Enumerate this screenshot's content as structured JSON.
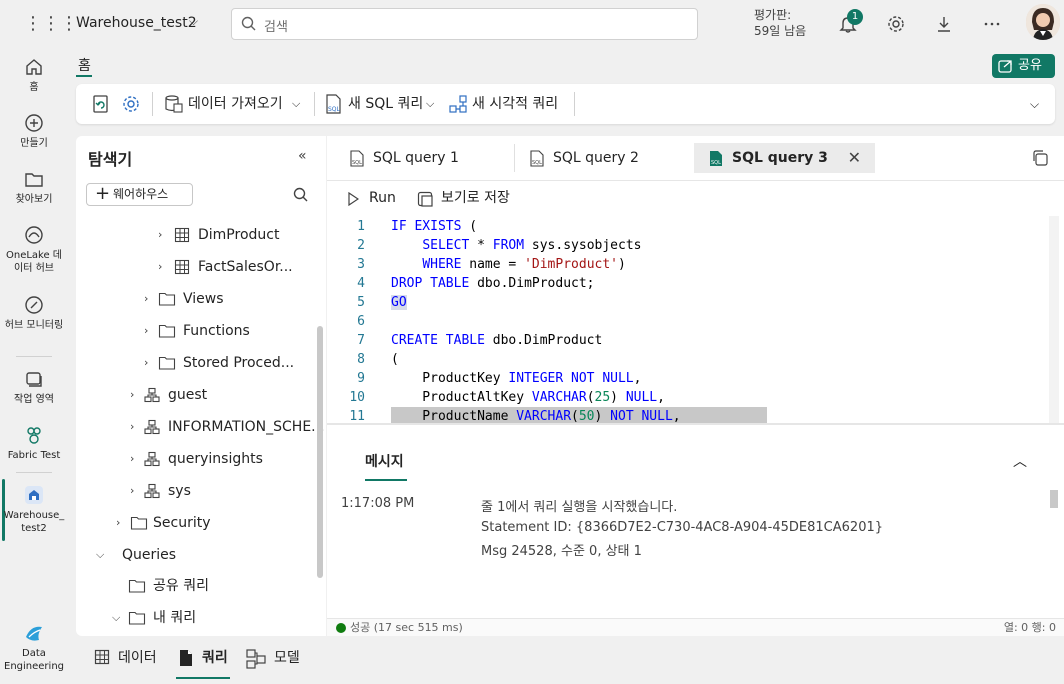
{
  "rail": {
    "home": "홈",
    "create": "만들기",
    "browse": "찾아보기",
    "onelake": "OneLake 데이터 허브",
    "monitor": "허브 모니터링",
    "workspace": "작업 영역",
    "fabric_test": "Fabric Test",
    "warehouse": "Warehouse_ test2",
    "data_engineering": "Data Engineering"
  },
  "topbar": {
    "workspace_name": "Warehouse_test2",
    "search_placeholder": "검색",
    "trial_line1": "평가판:",
    "trial_line2": "59일 남음",
    "notification_count": "1"
  },
  "ribbon": {
    "tab_home": "홈",
    "share": "공유",
    "get_data": "데이터 가져오기",
    "new_sql_query": "새 SQL 쿼리",
    "new_visual_query": "새 시각적 쿼리"
  },
  "explorer": {
    "title": "탐색기",
    "warehouse_button": "웨어하우스",
    "items": [
      "DimProduct",
      "FactSalesOr...",
      "Views",
      "Functions",
      "Stored Proced...",
      "guest",
      "INFORMATION_SCHE...",
      "queryinsights",
      "sys",
      "Security",
      "Queries",
      "공유 쿼리",
      "내 쿼리"
    ]
  },
  "editor": {
    "tabs": [
      "SQL query 1",
      "SQL query 2",
      "SQL query 3"
    ],
    "run": "Run",
    "save_as_view": "보기로 저장",
    "line_numbers": [
      "1",
      "2",
      "3",
      "4",
      "5",
      "6",
      "7",
      "8",
      "9",
      "10",
      "11"
    ]
  },
  "messages": {
    "tab": "메시지",
    "time": "1:17:08 PM",
    "line1": "줄 1에서 쿼리 실행을 시작했습니다.",
    "line2": "Statement ID: {8366D7E2-C730-4AC8-A904-45DE81CA6201}",
    "line3": "Msg 24528, 수준 0, 상태 1"
  },
  "status": {
    "left": "성공 (17 sec 515 ms)",
    "right": "열: 0  행: 0"
  },
  "view_tabs": {
    "data": "데이터",
    "query": "쿼리",
    "model": "모델"
  },
  "colors": {
    "accent": "#117865",
    "keyword": "#0000ff",
    "string": "#a31515",
    "number": "#098658"
  }
}
